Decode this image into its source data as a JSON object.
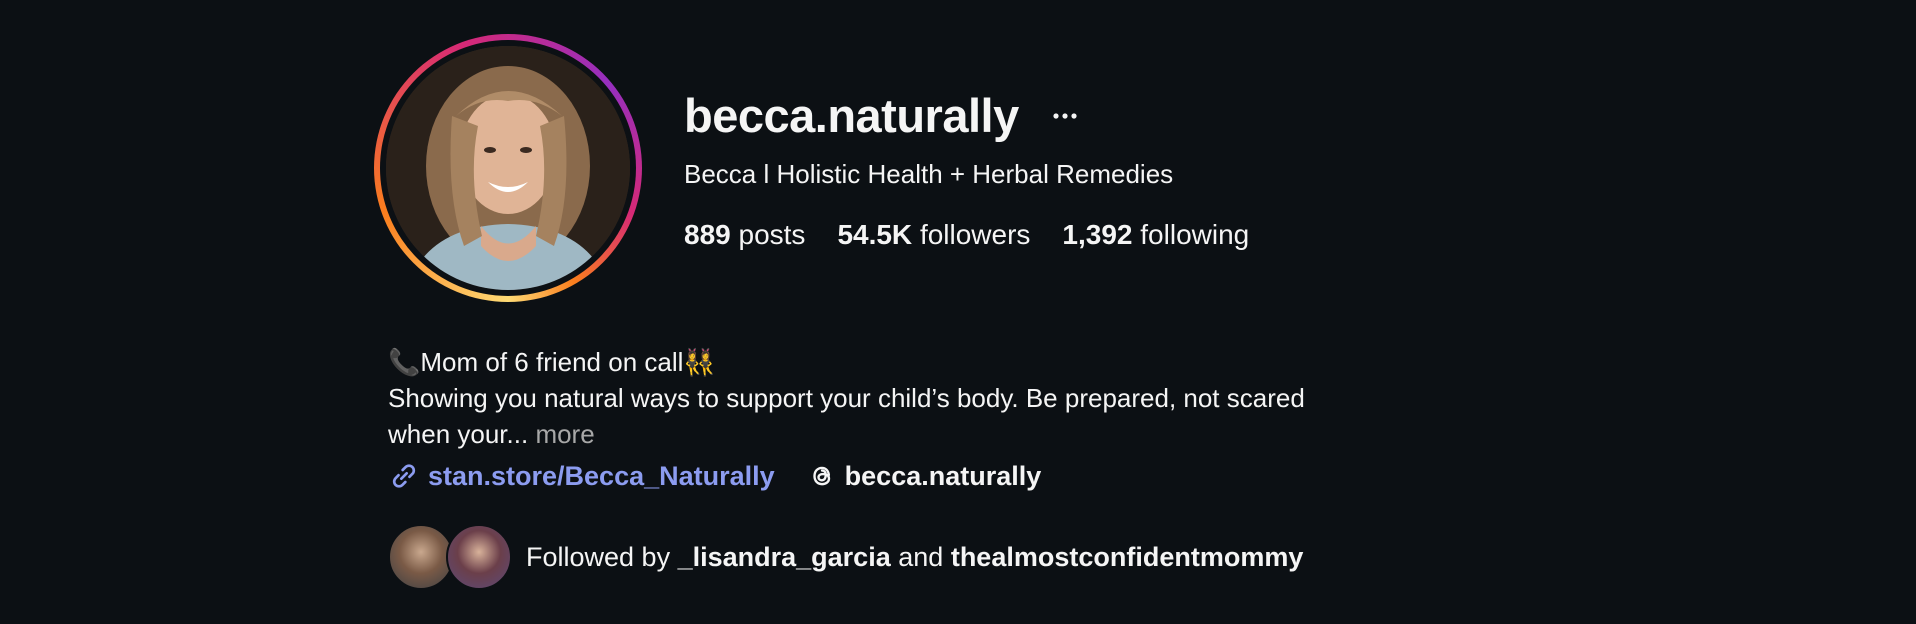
{
  "profile": {
    "username": "becca.naturally",
    "full_name": "Becca l Holistic Health + Herbal Remedies",
    "more_icon": "ellipsis-icon"
  },
  "stats": {
    "posts_count": "889",
    "posts_label": "posts",
    "followers_count": "54.5K",
    "followers_label": "followers",
    "following_count": "1,392",
    "following_label": "following"
  },
  "bio": {
    "line1_emoji": "📞",
    "line1_text": "Mom of 6 friend on call",
    "line1_trailing_emoji": "👯‍♀️",
    "line2": "Showing you natural ways to support your child’s body. Be prepared, not scared",
    "line3": "when your...",
    "more_label": "more"
  },
  "links": {
    "website_icon": "link-icon",
    "website_text": "stan.store/Becca_Naturally",
    "threads_icon": "threads-icon",
    "threads_text": "becca.naturally"
  },
  "followed_by": {
    "prefix": "Followed by",
    "user1": "_lisandra_garcia",
    "conjunction": "and",
    "user2": "thealmostconfidentmommy"
  },
  "colors": {
    "background": "#0c1014",
    "text": "#f5f5f5",
    "link": "#8c9cf0",
    "muted": "#a8a8a8"
  }
}
